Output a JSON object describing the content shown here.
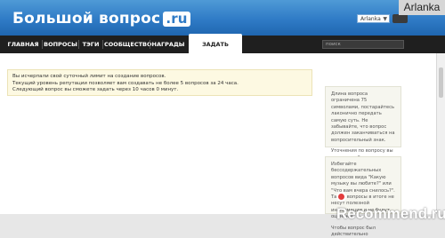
{
  "header": {
    "logo_text": "Большой вопрос",
    "logo_ru": ".ru",
    "user_select": "Arlanka",
    "watermark_user": "Arlanka"
  },
  "nav": {
    "items": [
      {
        "label": "ГЛАВНАЯ",
        "active": false
      },
      {
        "label": "ВОПРОСЫ",
        "active": false
      },
      {
        "label": "ТЭГИ",
        "active": false
      },
      {
        "label": "СООБЩЕСТВО",
        "active": false
      },
      {
        "label": "НАГРАДЫ",
        "active": false
      },
      {
        "label": "ЗАДАТЬ ВОПРОС",
        "active": true
      }
    ],
    "search_placeholder": "поиск"
  },
  "notice": {
    "lines": [
      "Вы исчерпали свой суточный лимит на создание вопросов.",
      "Текущий уровень репутации позволяет вам создавать не более 5 вопросов за 24 часа.",
      "Следующий вопрос вы сможете задать через 10 часов 0 минут."
    ]
  },
  "tips": [
    {
      "paragraphs": [
        "Длина вопроса ограничена 75 символами, постарайтесь лаконично передать самую суть. Не забывайте, что вопрос должен заканчиваться на вопросительный знак.",
        "Уточнения по вопросу вы можете добавить в поле Подробности. Если это необходимо."
      ]
    },
    {
      "paragraphs": [
        "Избегайте бессодержательных вопросов вида \"Какую музыку вы любите?\" или \"Что вам вчера снилось?\". Такие вопросы в итоге не несут полезной информации и не будут оценены.",
        "Чтобы вопрос был действительно"
      ]
    }
  ],
  "watermark": "Recommend.ru",
  "colors": {
    "header_blue": "#2f7bc6",
    "nav_dark": "#1f1f1f",
    "notice_bg": "#fdf9e2",
    "tip_bg": "#f6f6ef"
  }
}
